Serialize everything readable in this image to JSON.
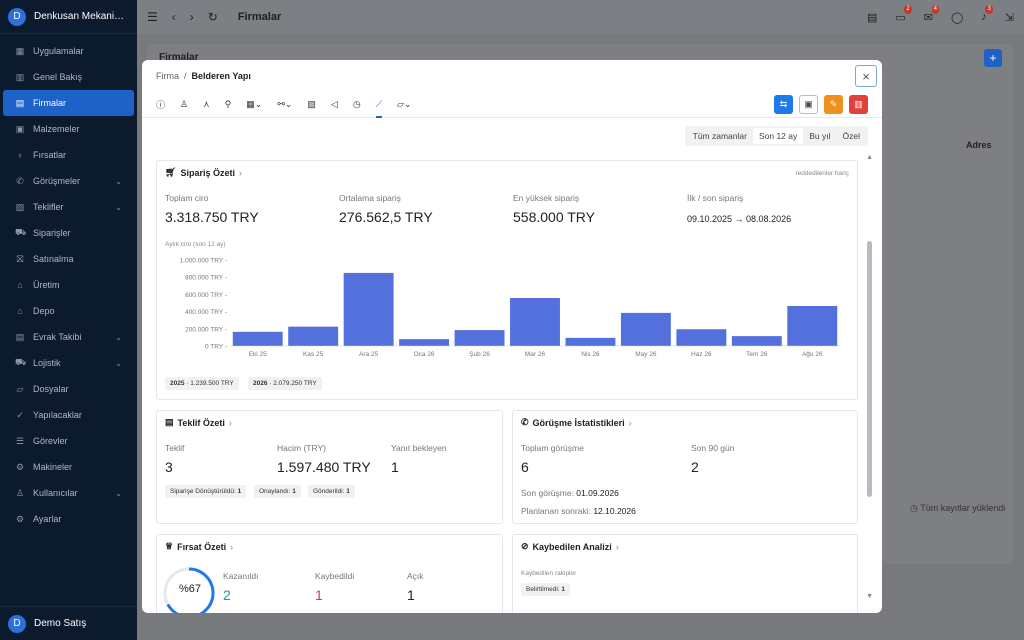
{
  "app": {
    "company_name": "Denkusan Mekanik San...",
    "avatar_letter": "D"
  },
  "sidebar": {
    "items": [
      {
        "label": "Uygulamalar",
        "icon": "grid"
      },
      {
        "label": "Genel Bakış",
        "icon": "chart"
      },
      {
        "label": "Firmalar",
        "icon": "building",
        "active": true
      },
      {
        "label": "Malzemeler",
        "icon": "box"
      },
      {
        "label": "Fırsatlar",
        "icon": "bulb"
      },
      {
        "label": "Görüşmeler",
        "icon": "phone",
        "chevron": true
      },
      {
        "label": "Teklifler",
        "icon": "doc",
        "chevron": true
      },
      {
        "label": "Siparişler",
        "icon": "cart"
      },
      {
        "label": "Satınalma",
        "icon": "bag"
      },
      {
        "label": "Üretim",
        "icon": "factory"
      },
      {
        "label": "Depo",
        "icon": "warehouse"
      },
      {
        "label": "Evrak Takibi",
        "icon": "file",
        "chevron": true
      },
      {
        "label": "Lojistik",
        "icon": "truck",
        "chevron": true
      },
      {
        "label": "Dosyalar",
        "icon": "folder"
      },
      {
        "label": "Yapılacaklar",
        "icon": "check"
      },
      {
        "label": "Görevler",
        "icon": "task"
      },
      {
        "label": "Makineler",
        "icon": "gear"
      },
      {
        "label": "Kullanıcılar",
        "icon": "users",
        "chevron": true
      },
      {
        "label": "Ayarlar",
        "icon": "settings"
      }
    ],
    "user": {
      "name": "Demo Satış",
      "avatar_letter": "D"
    }
  },
  "topbar": {
    "title": "Firmalar",
    "badges": [
      "2",
      "4",
      "3"
    ]
  },
  "background": {
    "page_title": "Firmalar",
    "column_header": "Adres",
    "footer_text": "Tüm kayıtlar yüklendi"
  },
  "modal": {
    "breadcrumb_parent": "Firma",
    "breadcrumb_sep": "/",
    "breadcrumb_current": "Belderen Yapı",
    "close_symbol": "×",
    "filters": [
      "Tüm zamanlar",
      "Son 12 ay",
      "Bu yıl",
      "Özel"
    ],
    "active_filter": "Son 12 ay",
    "order_summary": {
      "title": "Sipariş Özeti",
      "note": "reddedilenler hariç",
      "total_label": "Toplam ciro",
      "total_value": "3.318.750 TRY",
      "avg_label": "Ortalama sipariş",
      "avg_value": "276.562,5 TRY",
      "max_label": "En yüksek sipariş",
      "max_value": "558.000 TRY",
      "first_last_label": "İlk / son sipariş",
      "first_last_value": "09.10.2025 → 08.08.2026",
      "chart_caption": "Aylık ciro (son 12 ay)",
      "year_chips": [
        {
          "year": "2025",
          "value": "1.239.500 TRY"
        },
        {
          "year": "2026",
          "value": "2.079.250 TRY"
        }
      ]
    },
    "quote_summary": {
      "title": "Teklif Özeti",
      "count_label": "Teklif",
      "count_value": "3",
      "volume_label": "Hacim (TRY)",
      "volume_value": "1.597.480 TRY",
      "pending_label": "Yanıt bekleyen",
      "pending_value": "1",
      "chips": [
        {
          "label": "Siparişe Dönüştürüldü:",
          "value": "1"
        },
        {
          "label": "Onaylandı:",
          "value": "1"
        },
        {
          "label": "Gönderildi:",
          "value": "1"
        }
      ]
    },
    "meeting_stats": {
      "title": "Görüşme İstatistikleri",
      "total_label": "Toplam görüşme",
      "total_value": "6",
      "recent_label": "Son 90 gün",
      "recent_value": "2",
      "last_label": "Son görüşme",
      "last_value": "01.09.2026",
      "next_label": "Planlanan sonraki",
      "next_value": "12.10.2026"
    },
    "opportunity_summary": {
      "title": "Fırsat Özeti",
      "win_rate_text": "%67",
      "win_rate": 0.67,
      "won_label": "Kazanıldı",
      "won_value": "2",
      "lost_label": "Kaybedildi",
      "lost_value": "1",
      "open_label": "Açık",
      "open_value": "1"
    },
    "loss_analysis": {
      "title": "Kaybedilen Analizi",
      "sub_label": "Kaybedilen rakipler",
      "chip_label": "Belirtilmedi:",
      "chip_value": "1"
    }
  },
  "chart_data": {
    "type": "bar",
    "title": "Aylık ciro (son 12 ay)",
    "categories": [
      "Eki 25",
      "Kas 25",
      "Ara 25",
      "Oca 26",
      "Şub 26",
      "Mar 26",
      "Nis 26",
      "May 26",
      "Haz 26",
      "Tem 26",
      "Ağu 26"
    ],
    "values": [
      165000,
      225000,
      850000,
      80000,
      185000,
      558000,
      95000,
      385000,
      195000,
      115000,
      465000
    ],
    "yticks": [
      0,
      200000,
      400000,
      600000,
      800000,
      1000000
    ],
    "ytick_labels": [
      "0 TRY -",
      "200.000 TRY -",
      "400.000 TRY -",
      "600.000 TRY -",
      "800.000 TRY -",
      "1.000.000 TRY -"
    ],
    "ylim": [
      0,
      1000000
    ],
    "color": "#5470dd"
  }
}
